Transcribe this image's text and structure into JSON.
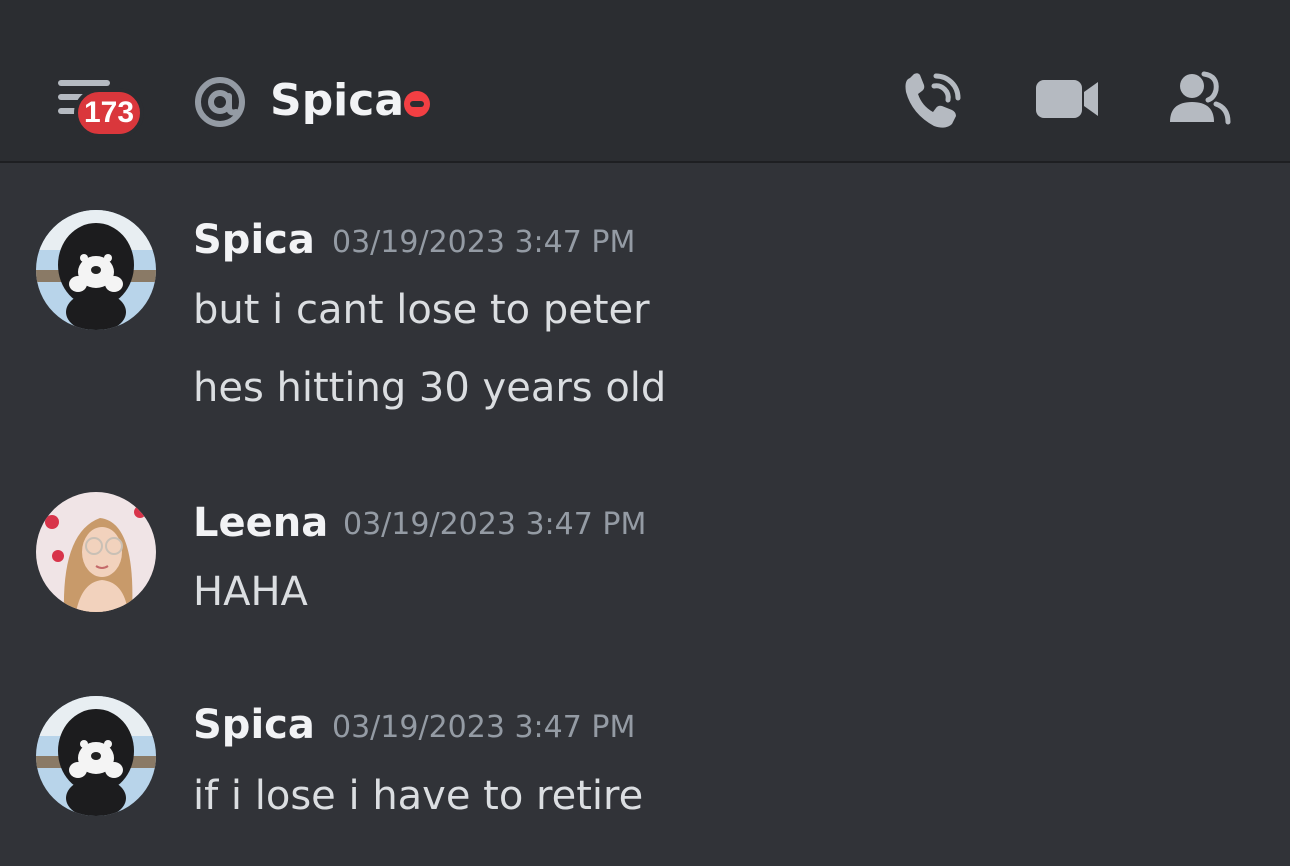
{
  "header": {
    "unread_badge": "173",
    "channel_name": "Spica"
  },
  "messages": [
    {
      "author": "Spica",
      "timestamp": "03/19/2023 3:47 PM",
      "lines": [
        "but i cant lose to peter",
        "hes hitting 30 years old"
      ]
    },
    {
      "author": "Leena",
      "timestamp": "03/19/2023 3:47 PM",
      "lines": [
        "HAHA"
      ]
    },
    {
      "author": "Spica",
      "timestamp": "03/19/2023 3:47 PM",
      "lines": [
        "if i lose i have to retire"
      ]
    }
  ],
  "colors": {
    "background": "#313338",
    "header_background": "#2b2d31",
    "badge": "#da373c",
    "status_dnd": "#f23f43",
    "icon": "#b5bac1"
  },
  "icons": {
    "menu": "menu-icon",
    "mention": "at-icon",
    "call": "phone-call-icon",
    "video": "video-camera-icon",
    "members": "members-icon",
    "status": "do-not-disturb-icon"
  }
}
